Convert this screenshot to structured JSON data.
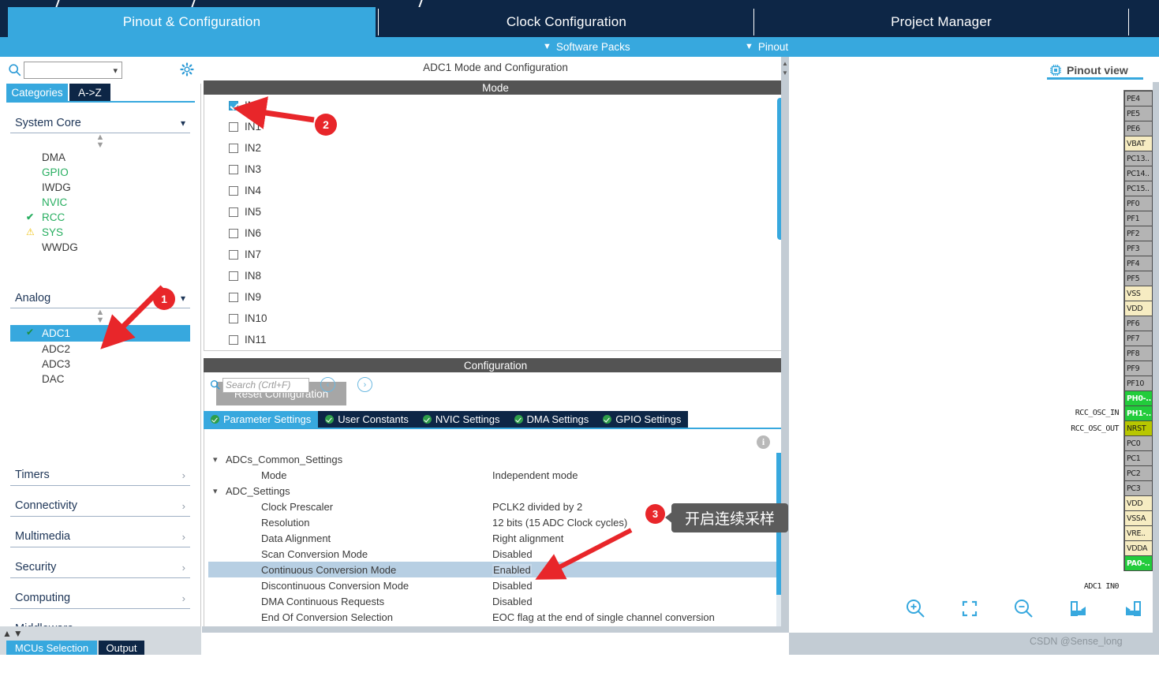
{
  "app": {
    "watermark": "CSDN @Sense_long"
  },
  "main_tabs": [
    {
      "label": "Pinout & Configuration",
      "active": true
    },
    {
      "label": "Clock Configuration",
      "active": false
    },
    {
      "label": "Project Manager",
      "active": false
    }
  ],
  "sub_bar": {
    "items": [
      {
        "label": "Software Packs",
        "icon": "chevron-down-icon"
      },
      {
        "label": "Pinout",
        "icon": "chevron-down-icon"
      }
    ]
  },
  "sidebar": {
    "search": {
      "value": "",
      "placeholder": ""
    },
    "icons": {
      "search": "search-icon",
      "gear": "gear-icon",
      "dropdown": "chevron-down-icon"
    },
    "view_tabs": [
      {
        "label": "Categories",
        "active": true
      },
      {
        "label": "A->Z",
        "active": false
      }
    ],
    "groups": [
      {
        "label": "System Core",
        "expanded": true,
        "items": [
          {
            "label": "DMA",
            "state": "none",
            "badge": ""
          },
          {
            "label": "GPIO",
            "state": "used",
            "badge": ""
          },
          {
            "label": "IWDG",
            "state": "none",
            "badge": ""
          },
          {
            "label": "NVIC",
            "state": "used",
            "badge": ""
          },
          {
            "label": "RCC",
            "state": "used",
            "badge": "check"
          },
          {
            "label": "SYS",
            "state": "used",
            "badge": "warn"
          },
          {
            "label": "WWDG",
            "state": "none",
            "badge": ""
          }
        ]
      },
      {
        "label": "Analog",
        "expanded": true,
        "items": [
          {
            "label": "ADC1",
            "state": "selected",
            "badge": "check"
          },
          {
            "label": "ADC2",
            "state": "none",
            "badge": ""
          },
          {
            "label": "ADC3",
            "state": "none",
            "badge": ""
          },
          {
            "label": "DAC",
            "state": "none",
            "badge": ""
          }
        ]
      }
    ],
    "collapsed_groups": [
      "Timers",
      "Connectivity",
      "Multimedia",
      "Security",
      "Computing",
      "Middleware"
    ],
    "bottom_tabs": [
      {
        "label": "MCUs Selection",
        "active": true
      },
      {
        "label": "Output",
        "active": false
      }
    ]
  },
  "center": {
    "title": "ADC1 Mode and Configuration",
    "mode_header": "Mode",
    "configuration_header": "Configuration",
    "reset_button": "Reset Configuration",
    "channels": [
      {
        "label": "IN0",
        "checked": true
      },
      {
        "label": "IN1",
        "checked": false
      },
      {
        "label": "IN2",
        "checked": false
      },
      {
        "label": "IN3",
        "checked": false
      },
      {
        "label": "IN4",
        "checked": false
      },
      {
        "label": "IN5",
        "checked": false
      },
      {
        "label": "IN6",
        "checked": false
      },
      {
        "label": "IN7",
        "checked": false
      },
      {
        "label": "IN8",
        "checked": false
      },
      {
        "label": "IN9",
        "checked": false
      },
      {
        "label": "IN10",
        "checked": false
      },
      {
        "label": "IN11",
        "checked": false
      }
    ],
    "config_tabs": [
      {
        "label": "Parameter Settings",
        "active": true
      },
      {
        "label": "User Constants",
        "active": false
      },
      {
        "label": "NVIC Settings",
        "active": false
      },
      {
        "label": "DMA Settings",
        "active": false
      },
      {
        "label": "GPIO Settings",
        "active": false
      }
    ],
    "param_search": {
      "value": "",
      "placeholder": "Search (Crtl+F)"
    },
    "nav_prev": "‹",
    "nav_next": "›",
    "info_icon_label": "i",
    "parameter_tree": [
      {
        "kind": "group",
        "name": "ADCs_Common_Settings",
        "expanded": true
      },
      {
        "kind": "row",
        "name": "Mode",
        "value": "Independent mode",
        "selected": false
      },
      {
        "kind": "group",
        "name": "ADC_Settings",
        "expanded": true
      },
      {
        "kind": "row",
        "name": "Clock Prescaler",
        "value": "PCLK2 divided by 2",
        "selected": false
      },
      {
        "kind": "row",
        "name": "Resolution",
        "value": "12 bits (15 ADC Clock cycles)",
        "selected": false
      },
      {
        "kind": "row",
        "name": "Data Alignment",
        "value": "Right alignment",
        "selected": false
      },
      {
        "kind": "row",
        "name": "Scan Conversion Mode",
        "value": "Disabled",
        "selected": false
      },
      {
        "kind": "row",
        "name": "Continuous Conversion Mode",
        "value": "Enabled",
        "selected": true
      },
      {
        "kind": "row",
        "name": "Discontinuous Conversion Mode",
        "value": "Disabled",
        "selected": false
      },
      {
        "kind": "row",
        "name": "DMA Continuous Requests",
        "value": "Disabled",
        "selected": false
      },
      {
        "kind": "row",
        "name": "End Of Conversion Selection",
        "value": "EOC flag at the end of single channel conversion",
        "selected": false
      }
    ]
  },
  "right": {
    "pinout_view_label": "Pinout view",
    "pinout_view_icon": "chip-icon",
    "pins": [
      {
        "label": "PE4",
        "type": "gray",
        "signal": ""
      },
      {
        "label": "PE5",
        "type": "gray",
        "signal": ""
      },
      {
        "label": "PE6",
        "type": "gray",
        "signal": ""
      },
      {
        "label": "VBAT",
        "type": "cream",
        "signal": ""
      },
      {
        "label": "PC13..",
        "type": "gray",
        "signal": ""
      },
      {
        "label": "PC14..",
        "type": "gray",
        "signal": ""
      },
      {
        "label": "PC15..",
        "type": "gray",
        "signal": ""
      },
      {
        "label": "PF0",
        "type": "gray",
        "signal": ""
      },
      {
        "label": "PF1",
        "type": "gray",
        "signal": ""
      },
      {
        "label": "PF2",
        "type": "gray",
        "signal": ""
      },
      {
        "label": "PF3",
        "type": "gray",
        "signal": ""
      },
      {
        "label": "PF4",
        "type": "gray",
        "signal": ""
      },
      {
        "label": "PF5",
        "type": "gray",
        "signal": ""
      },
      {
        "label": "VSS",
        "type": "cream",
        "signal": ""
      },
      {
        "label": "VDD",
        "type": "cream",
        "signal": ""
      },
      {
        "label": "PF6",
        "type": "gray",
        "signal": ""
      },
      {
        "label": "PF7",
        "type": "gray",
        "signal": ""
      },
      {
        "label": "PF8",
        "type": "gray",
        "signal": ""
      },
      {
        "label": "PF9",
        "type": "gray",
        "signal": ""
      },
      {
        "label": "PF10",
        "type": "gray",
        "signal": ""
      },
      {
        "label": "PH0-..",
        "type": "green",
        "signal": "RCC_OSC_IN"
      },
      {
        "label": "PH1-..",
        "type": "green",
        "signal": "RCC_OSC_OUT"
      },
      {
        "label": "NRST",
        "type": "olive",
        "signal": ""
      },
      {
        "label": "PC0",
        "type": "gray",
        "signal": ""
      },
      {
        "label": "PC1",
        "type": "gray",
        "signal": ""
      },
      {
        "label": "PC2",
        "type": "gray",
        "signal": ""
      },
      {
        "label": "PC3",
        "type": "gray",
        "signal": ""
      },
      {
        "label": "VDD",
        "type": "cream",
        "signal": ""
      },
      {
        "label": "VSSA",
        "type": "cream",
        "signal": ""
      },
      {
        "label": "VRE..",
        "type": "cream",
        "signal": ""
      },
      {
        "label": "VDDA",
        "type": "cream",
        "signal": ""
      },
      {
        "label": "PA0-..",
        "type": "green",
        "signal": "ADC1 IN0"
      }
    ],
    "zoom_tools": [
      {
        "name": "zoom-in-icon"
      },
      {
        "name": "fit-to-screen-icon"
      },
      {
        "name": "zoom-out-icon"
      },
      {
        "name": "rotate-right-icon"
      },
      {
        "name": "rotate-left-icon"
      }
    ]
  },
  "annotations": [
    {
      "id": "1",
      "number": "1",
      "text": ""
    },
    {
      "id": "2",
      "number": "2",
      "text": ""
    },
    {
      "id": "3",
      "number": "3",
      "text": "开启连续采样"
    }
  ],
  "colors": {
    "accent": "#37a8de",
    "navy": "#0d2646",
    "annotation_red": "#e8262a",
    "selected_row": "#b7cfe3",
    "header_gray": "#545454"
  }
}
